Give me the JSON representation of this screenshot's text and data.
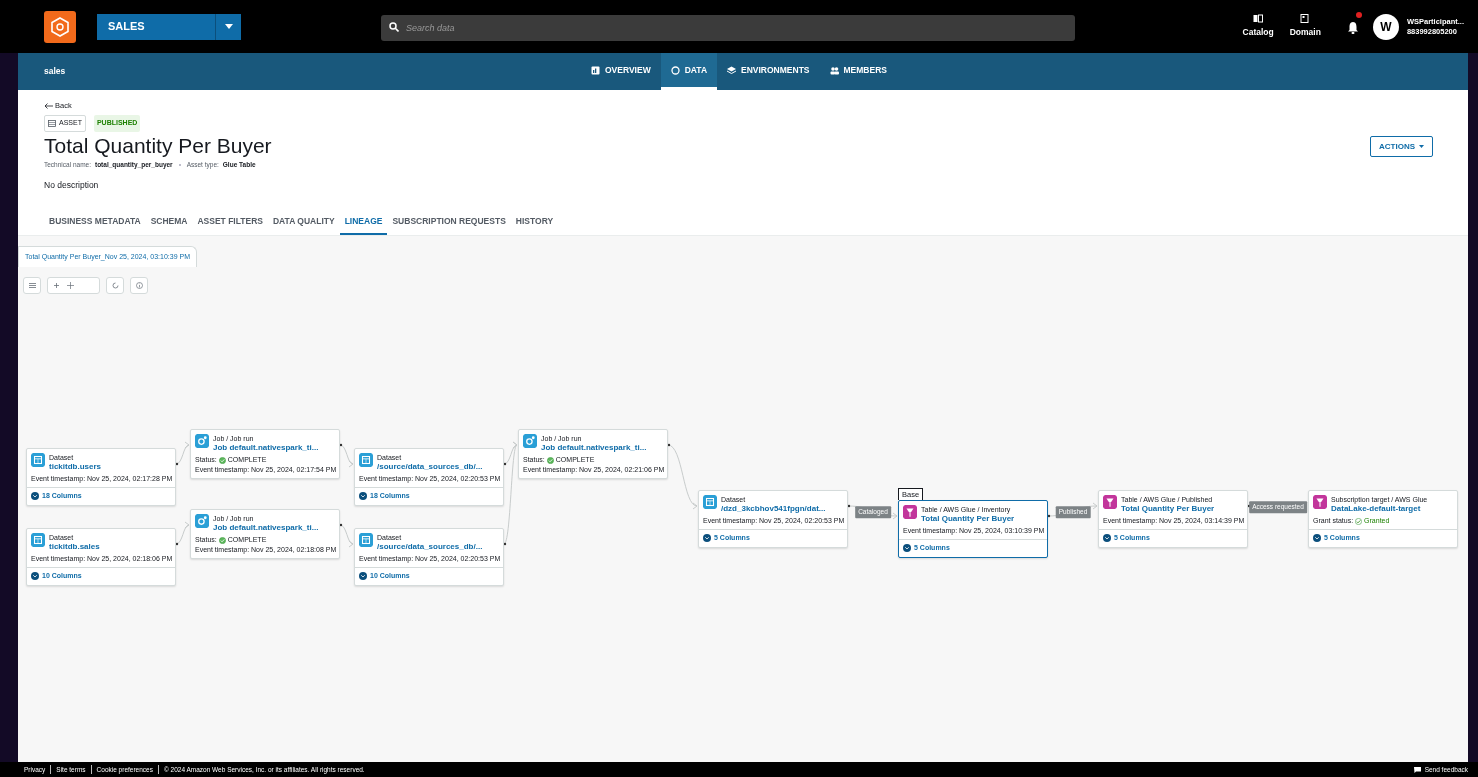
{
  "top_bar": {
    "project": "SALES",
    "search_placeholder": "Search data",
    "shortcuts": [
      {
        "kind": "catalog",
        "label": "Catalog"
      },
      {
        "kind": "domain",
        "label": "Domain"
      }
    ],
    "notifications": {
      "unread": true
    },
    "user": {
      "initial": "W",
      "name": "WSParticipant...",
      "account": "883992805200"
    }
  },
  "nav": {
    "project_name": "sales",
    "tabs": [
      {
        "kind": "overview",
        "label": "OVERVIEW",
        "selected": false
      },
      {
        "kind": "data",
        "label": "DATA",
        "selected": true
      },
      {
        "kind": "environments",
        "label": "ENVIRONMENTS",
        "selected": false
      },
      {
        "kind": "members",
        "label": "MEMBERS",
        "selected": false
      }
    ]
  },
  "asset": {
    "back": "Back",
    "type_badge": "ASSET",
    "status_badge": "PUBLISHED",
    "title": "Total Quantity Per Buyer",
    "technical_name_label": "Technical name:",
    "technical_name": "total_quantity_per_buyer",
    "asset_type_label": "Asset type:",
    "asset_type": "Glue Table",
    "description": "No description",
    "actions": "ACTIONS"
  },
  "tabs": [
    {
      "label": "BUSINESS METADATA",
      "selected": false
    },
    {
      "label": "SCHEMA",
      "selected": false
    },
    {
      "label": "ASSET FILTERS",
      "selected": false
    },
    {
      "label": "DATA QUALITY",
      "selected": false
    },
    {
      "label": "LINEAGE",
      "selected": true
    },
    {
      "label": "SUBSCRIPTION REQUESTS",
      "selected": false
    },
    {
      "label": "HISTORY",
      "selected": false
    }
  ],
  "lineage": {
    "version_tab": "Total Quantity Per Buyer_Nov 25, 2024, 03:10:39 PM",
    "nodes": [
      {
        "kind": "dataset",
        "type": "Dataset",
        "name": "tickitdb.users",
        "timestamp": "Event timestamp: Nov 25, 2024, 02:17:28 PM",
        "columns": "18 Columns"
      },
      {
        "kind": "dataset",
        "type": "Dataset",
        "name": "tickitdb.sales",
        "timestamp": "Event timestamp: Nov 25, 2024, 02:18:06 PM",
        "columns": "10 Columns"
      },
      {
        "kind": "job",
        "type": "Job / Job run",
        "name": "Job default.nativespark_ti...",
        "status_label": "Status:",
        "status": "COMPLETE",
        "timestamp": "Event timestamp: Nov 25, 2024, 02:17:54 PM"
      },
      {
        "kind": "job",
        "type": "Job / Job run",
        "name": "Job default.nativespark_ti...",
        "status_label": "Status:",
        "status": "COMPLETE",
        "timestamp": "Event timestamp: Nov 25, 2024, 02:18:08 PM"
      },
      {
        "kind": "dataset",
        "type": "Dataset",
        "name": "/source/data_sources_db/...",
        "timestamp": "Event timestamp: Nov 25, 2024, 02:20:53 PM",
        "columns": "18 Columns"
      },
      {
        "kind": "dataset",
        "type": "Dataset",
        "name": "/source/data_sources_db/...",
        "timestamp": "Event timestamp: Nov 25, 2024, 02:20:53 PM",
        "columns": "10 Columns"
      },
      {
        "kind": "job",
        "type": "Job / Job run",
        "name": "Job default.nativespark_ti...",
        "status_label": "Status:",
        "status": "COMPLETE",
        "timestamp": "Event timestamp: Nov 25, 2024, 02:21:06 PM"
      },
      {
        "kind": "dataset",
        "type": "Dataset",
        "name": "/dzd_3kcbhov541fpgn/dat...",
        "timestamp": "Event timestamp: Nov 25, 2024, 02:20:53 PM",
        "columns": "5 Columns"
      },
      {
        "kind": "table",
        "badge": "Base",
        "type": "Table / AWS Glue / Inventory",
        "name": "Total Quantity Per Buyer",
        "timestamp": "Event timestamp: Nov 25, 2024, 03:10:39 PM",
        "columns": "5 Columns"
      },
      {
        "kind": "table",
        "type": "Table / AWS Glue / Published",
        "name": "Total Quantity Per Buyer",
        "timestamp": "Event timestamp: Nov 25, 2024, 03:14:39 PM",
        "columns": "5 Columns"
      },
      {
        "kind": "target",
        "type": "Subscription target / AWS Glue",
        "name": "DataLake-default-target",
        "grant_label": "Grant status:",
        "grant": "Granted",
        "columns": "5 Columns"
      }
    ],
    "edge_labels": [
      "Cataloged",
      "Published",
      "Access requested"
    ]
  },
  "footer": {
    "links": [
      "Privacy",
      "Site terms",
      "Cookie preferences"
    ],
    "copyright": "© 2024 Amazon Web Services, Inc. or its affiliates. All rights reserved.",
    "feedback": "Send feedback"
  }
}
